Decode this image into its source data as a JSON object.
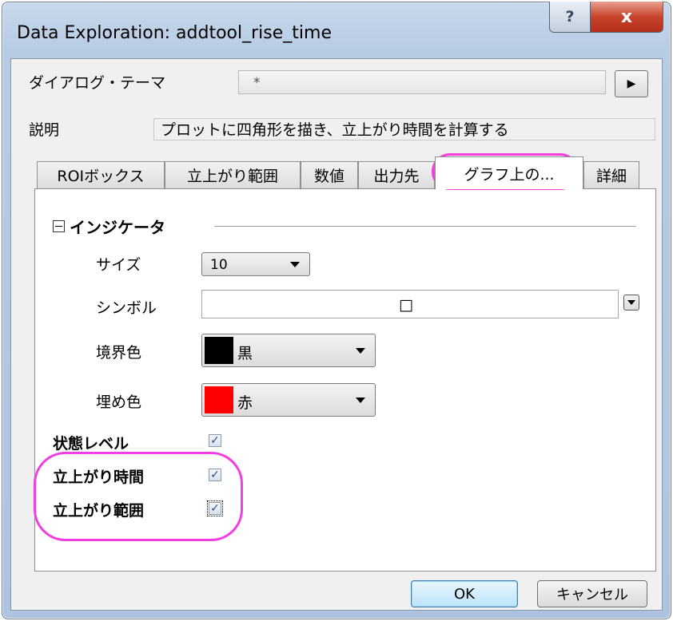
{
  "window": {
    "title": "Data Exploration: addtool_rise_time",
    "help_glyph": "?",
    "close_glyph": "x"
  },
  "theme": {
    "label": "ダイアログ・テーマ",
    "value": "*",
    "arrow_glyph": "▶"
  },
  "description": {
    "label": "説明",
    "value": "プロットに四角形を描き、立上がり時間を計算する"
  },
  "tabs": [
    {
      "label": "ROIボックス"
    },
    {
      "label": "立上がり範囲"
    },
    {
      "label": "数値"
    },
    {
      "label": "出力先"
    },
    {
      "label": "グラフ上の..."
    },
    {
      "label": "詳細"
    }
  ],
  "active_tab": "グラフ上の...",
  "indicator": {
    "section_title": "インジケータ",
    "size": {
      "label": "サイズ",
      "value": "10"
    },
    "symbol": {
      "label": "シンボル",
      "value": "□"
    },
    "border_color": {
      "label": "境界色",
      "value": "黒",
      "swatch": "#000000"
    },
    "fill_color": {
      "label": "埋め色",
      "value": "赤",
      "swatch": "#ff0000"
    }
  },
  "options": [
    {
      "label": "状態レベル",
      "checked": true,
      "mark": "✓"
    },
    {
      "label": "立上がり時間",
      "checked": true,
      "mark": "✓"
    },
    {
      "label": "立上がり範囲",
      "checked": true,
      "mark": "✓"
    }
  ],
  "buttons": {
    "ok": "OK",
    "cancel": "キャンセル"
  },
  "colors": {
    "highlight": "#f23ee0",
    "close_red": "#c7432a"
  }
}
